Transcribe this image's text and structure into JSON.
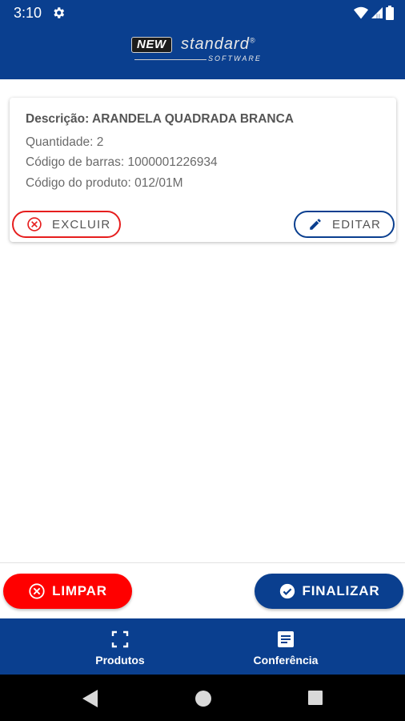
{
  "status_bar": {
    "time": "3:10"
  },
  "header": {
    "logo_new": "NEW",
    "logo_standard": "standard",
    "logo_reg": "®",
    "logo_software": "SOFTWARE",
    "background": "#0a3f8f"
  },
  "card": {
    "description": "Descrição: ARANDELA QUADRADA BRANCA",
    "quantity": "Quantidade: 2",
    "barcode": "Código de barras: 1000001226934",
    "product_code": "Código do produto: 012/01M",
    "delete_label": "EXCLUIR",
    "edit_label": "EDITAR"
  },
  "actions": {
    "clear_label": "LIMPAR",
    "finish_label": "FINALIZAR",
    "clear_color": "#ff0000",
    "finish_color": "#0a3f8f"
  },
  "bottom_nav": {
    "items": [
      {
        "label": "Produtos",
        "icon": "scan-icon"
      },
      {
        "label": "Conferência",
        "icon": "document-icon"
      }
    ]
  },
  "system_nav": {
    "icons": [
      "back-icon",
      "home-icon",
      "recents-icon"
    ]
  }
}
